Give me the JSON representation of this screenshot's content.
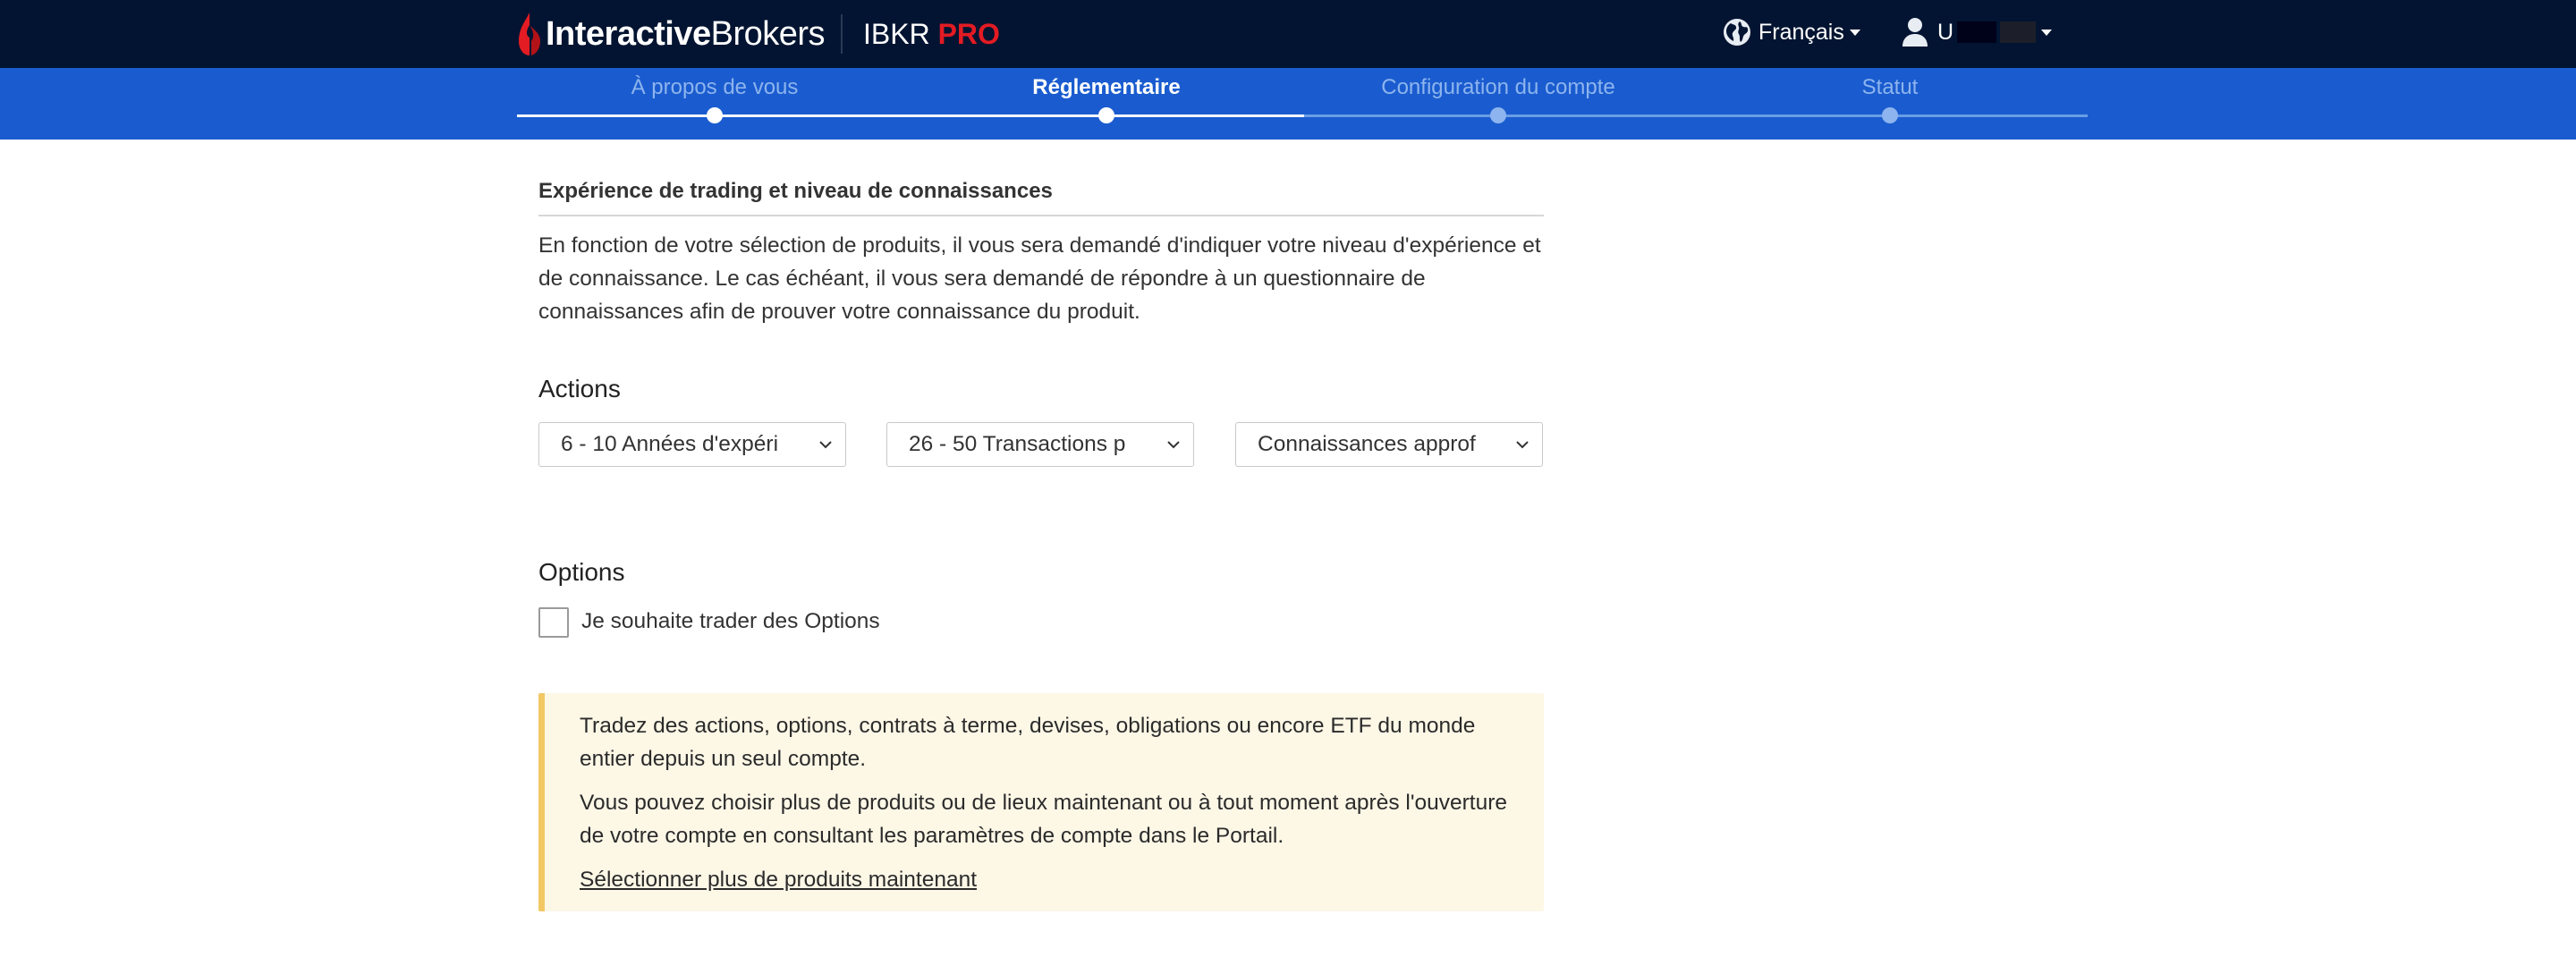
{
  "header": {
    "brand_bold": "Interactive",
    "brand_regular": "Brokers",
    "product_name": "IBKR",
    "product_suffix": "PRO",
    "language": "Français",
    "user": "U"
  },
  "steps": [
    {
      "label": "À propos de vous",
      "state": "done"
    },
    {
      "label": "Réglementaire",
      "state": "current"
    },
    {
      "label": "Configuration du compte",
      "state": "todo"
    },
    {
      "label": "Statut",
      "state": "todo"
    }
  ],
  "section": {
    "title": "Expérience de trading et niveau de connaissances",
    "intro": "En fonction de votre sélection de produits, il vous sera demandé d'indiquer votre niveau d'expérience et de connaissance. Le cas échéant, il vous sera demandé de répondre à un questionnaire de connaissances afin de prouver votre connaissance du produit."
  },
  "actions": {
    "title": "Actions",
    "experience_years": "6 - 10 Années d'expéri",
    "transactions": "26 - 50 Transactions p",
    "knowledge": "Connaissances approf"
  },
  "options": {
    "title": "Options",
    "checkbox_label": "Je souhaite trader des Options",
    "checked": false
  },
  "notice": {
    "paragraph1": "Tradez des actions, options, contrats à terme, devises, obligations ou encore ETF du monde entier depuis un seul compte.",
    "paragraph2": "Vous pouvez choisir plus de produits ou de lieux maintenant ou à tout moment après l'ouverture de votre compte en consultant les paramètres de compte dans le Portail.",
    "link": "Sélectionner plus de produits maintenant"
  },
  "colors": {
    "header_bg": "#021431",
    "stepbar_bg": "#1a5ccf",
    "brand_red": "#e31b23",
    "notice_bg": "#fdf7e6",
    "notice_border": "#f2c865"
  }
}
